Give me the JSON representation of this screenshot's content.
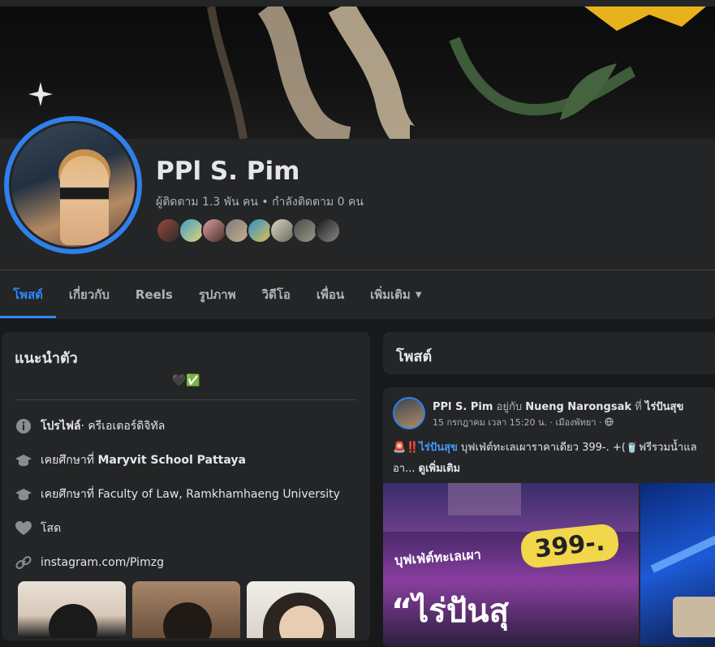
{
  "profile": {
    "name": "PPl S. Pim",
    "followers_text": "ผู้ติดตาม 1.3 พัน คน • กำลังติดตาม 0 คน"
  },
  "tabs": [
    {
      "label": "โพสต์",
      "active": true
    },
    {
      "label": "เกี่ยวกับ"
    },
    {
      "label": "Reels"
    },
    {
      "label": "รูปภาพ"
    },
    {
      "label": "วิดีโอ"
    },
    {
      "label": "เพื่อน"
    },
    {
      "label": "เพิ่มเติม"
    }
  ],
  "intro": {
    "title": "แนะนำตัว",
    "bio": "🖤✅",
    "rows": [
      {
        "icon": "info-icon",
        "prefix": "",
        "bold": "โปรไฟล์",
        "text": " · ครีเอเตอร์ดิจิทัล"
      },
      {
        "icon": "graduation-cap-icon",
        "prefix": "เคยศึกษาที่ ",
        "bold": "Maryvit School Pattaya",
        "text": ""
      },
      {
        "icon": "graduation-cap-icon",
        "prefix": "เคยศึกษาที่ ",
        "bold": "",
        "text": "Faculty of Law, Ramkhamhaeng University"
      },
      {
        "icon": "heart-icon",
        "prefix": "",
        "bold": "",
        "text": "โสด"
      },
      {
        "icon": "link-icon",
        "prefix": "",
        "bold": "",
        "text": "instagram.com/Pimzg"
      }
    ]
  },
  "posts": {
    "title": "โพสต์",
    "post": {
      "author": "PPl S. Pim",
      "with_word": "อยู่กับ",
      "tagged": "Nueng Narongsak",
      "at_word": "ที่",
      "place": "ไร่ปันสุข",
      "meta": "15 กรกฎาคม เวลา 15:20 น. · เมืองพัทยา ·",
      "text_line1_prefix": "🚨‼️",
      "text_line1_link": "ไร่ปันสุข",
      "text_line1_rest": " บุฟเฟ่ต์ทะเลเผาราคาเดียว 399-. +(🥤ฟรีรวมน้ำแล",
      "text_line2": "อา... ",
      "see_more": "ดูเพิ่มเติม",
      "image_price": "399-.",
      "image_sub": "บุฟเฟ่ต์ทะเลเผา",
      "image_big": "“ไร่ปันสุ"
    }
  },
  "colors": {
    "accent": "#2d88ff",
    "card": "#242526",
    "bg": "#18191a"
  }
}
